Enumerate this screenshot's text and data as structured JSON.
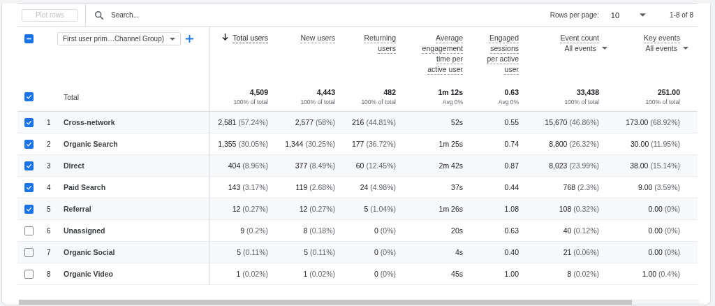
{
  "toolbar": {
    "plot_button": {
      "label": "Plot rows",
      "disabled": true
    },
    "search": {
      "placeholder": "Search..."
    },
    "rows_per_page_label": "Rows per page:",
    "rows_per_page": "10",
    "range": "1-8 of 8"
  },
  "dimension": {
    "label": "First user prim…Channel Group)",
    "select_all_indeterminate": true
  },
  "columns": [
    {
      "label": "Total users",
      "sorted": true
    },
    {
      "label": "New users",
      "sorted": false
    },
    {
      "label": "Returning users",
      "sorted": false
    },
    {
      "label": "Average engagement time per active user",
      "sorted": false
    },
    {
      "label": "Engaged sessions per active user",
      "sorted": false
    },
    {
      "label": "Event count",
      "sorted": false,
      "filter": "All events"
    },
    {
      "label": "Key events",
      "sorted": false,
      "filter": "All events"
    }
  ],
  "total": {
    "label": "Total",
    "checked": true,
    "cells": [
      {
        "value": "4,509",
        "note": "100% of total"
      },
      {
        "value": "4,443",
        "note": "100% of total"
      },
      {
        "value": "482",
        "note": "100% of total"
      },
      {
        "value": "1m 12s",
        "note": "Avg 0%"
      },
      {
        "value": "0.63",
        "note": "Avg 0%"
      },
      {
        "value": "33,438",
        "note": "100% of total"
      },
      {
        "value": "251.00",
        "note": "100% of total"
      }
    ]
  },
  "rows": [
    {
      "number": "1",
      "name": "Cross-network",
      "checked": true,
      "cells": [
        {
          "value": "2,581",
          "share": "(57.24%)"
        },
        {
          "value": "2,577",
          "share": "(58%)"
        },
        {
          "value": "216",
          "share": "(44.81%)"
        },
        {
          "value": "52s"
        },
        {
          "value": "0.55"
        },
        {
          "value": "15,670",
          "share": "(46.86%)"
        },
        {
          "value": "173.00",
          "share": "(68.92%)"
        }
      ]
    },
    {
      "number": "2",
      "name": "Organic Search",
      "checked": true,
      "cells": [
        {
          "value": "1,355",
          "share": "(30.05%)"
        },
        {
          "value": "1,344",
          "share": "(30.25%)"
        },
        {
          "value": "177",
          "share": "(36.72%)"
        },
        {
          "value": "1m 25s"
        },
        {
          "value": "0.74"
        },
        {
          "value": "8,800",
          "share": "(26.32%)"
        },
        {
          "value": "30.00",
          "share": "(11.95%)"
        }
      ]
    },
    {
      "number": "3",
      "name": "Direct",
      "checked": true,
      "cells": [
        {
          "value": "404",
          "share": "(8.96%)"
        },
        {
          "value": "377",
          "share": "(8.49%)"
        },
        {
          "value": "60",
          "share": "(12.45%)"
        },
        {
          "value": "2m 42s"
        },
        {
          "value": "0.87"
        },
        {
          "value": "8,023",
          "share": "(23.99%)"
        },
        {
          "value": "38.00",
          "share": "(15.14%)"
        }
      ]
    },
    {
      "number": "4",
      "name": "Paid Search",
      "checked": true,
      "cells": [
        {
          "value": "143",
          "share": "(3.17%)"
        },
        {
          "value": "119",
          "share": "(2.68%)"
        },
        {
          "value": "24",
          "share": "(4.98%)"
        },
        {
          "value": "37s"
        },
        {
          "value": "0.44"
        },
        {
          "value": "768",
          "share": "(2.3%)"
        },
        {
          "value": "9.00",
          "share": "(3.59%)"
        }
      ]
    },
    {
      "number": "5",
      "name": "Referral",
      "checked": true,
      "cells": [
        {
          "value": "12",
          "share": "(0.27%)"
        },
        {
          "value": "12",
          "share": "(0.27%)"
        },
        {
          "value": "5",
          "share": "(1.04%)"
        },
        {
          "value": "1m 26s"
        },
        {
          "value": "1.08"
        },
        {
          "value": "108",
          "share": "(0.32%)"
        },
        {
          "value": "0.00",
          "share": "(0%)"
        }
      ]
    },
    {
      "number": "6",
      "name": "Unassigned",
      "checked": false,
      "cells": [
        {
          "value": "9",
          "share": "(0.2%)"
        },
        {
          "value": "8",
          "share": "(0.18%)"
        },
        {
          "value": "0",
          "share": "(0%)"
        },
        {
          "value": "20s"
        },
        {
          "value": "0.63"
        },
        {
          "value": "40",
          "share": "(0.12%)"
        },
        {
          "value": "0.00",
          "share": "(0%)"
        }
      ]
    },
    {
      "number": "7",
      "name": "Organic Social",
      "checked": false,
      "cells": [
        {
          "value": "5",
          "share": "(0.11%)"
        },
        {
          "value": "5",
          "share": "(0.11%)"
        },
        {
          "value": "0",
          "share": "(0%)"
        },
        {
          "value": "4s"
        },
        {
          "value": "0.40"
        },
        {
          "value": "21",
          "share": "(0.06%)"
        },
        {
          "value": "0.00",
          "share": "(0%)"
        }
      ]
    },
    {
      "number": "8",
      "name": "Organic Video",
      "checked": false,
      "cells": [
        {
          "value": "1",
          "share": "(0.02%)"
        },
        {
          "value": "1",
          "share": "(0.02%)"
        },
        {
          "value": "0",
          "share": "(0%)"
        },
        {
          "value": "45s"
        },
        {
          "value": "1.00"
        },
        {
          "value": "8",
          "share": "(0.02%)"
        },
        {
          "value": "1.00",
          "share": "(0.4%)"
        }
      ]
    }
  ]
}
